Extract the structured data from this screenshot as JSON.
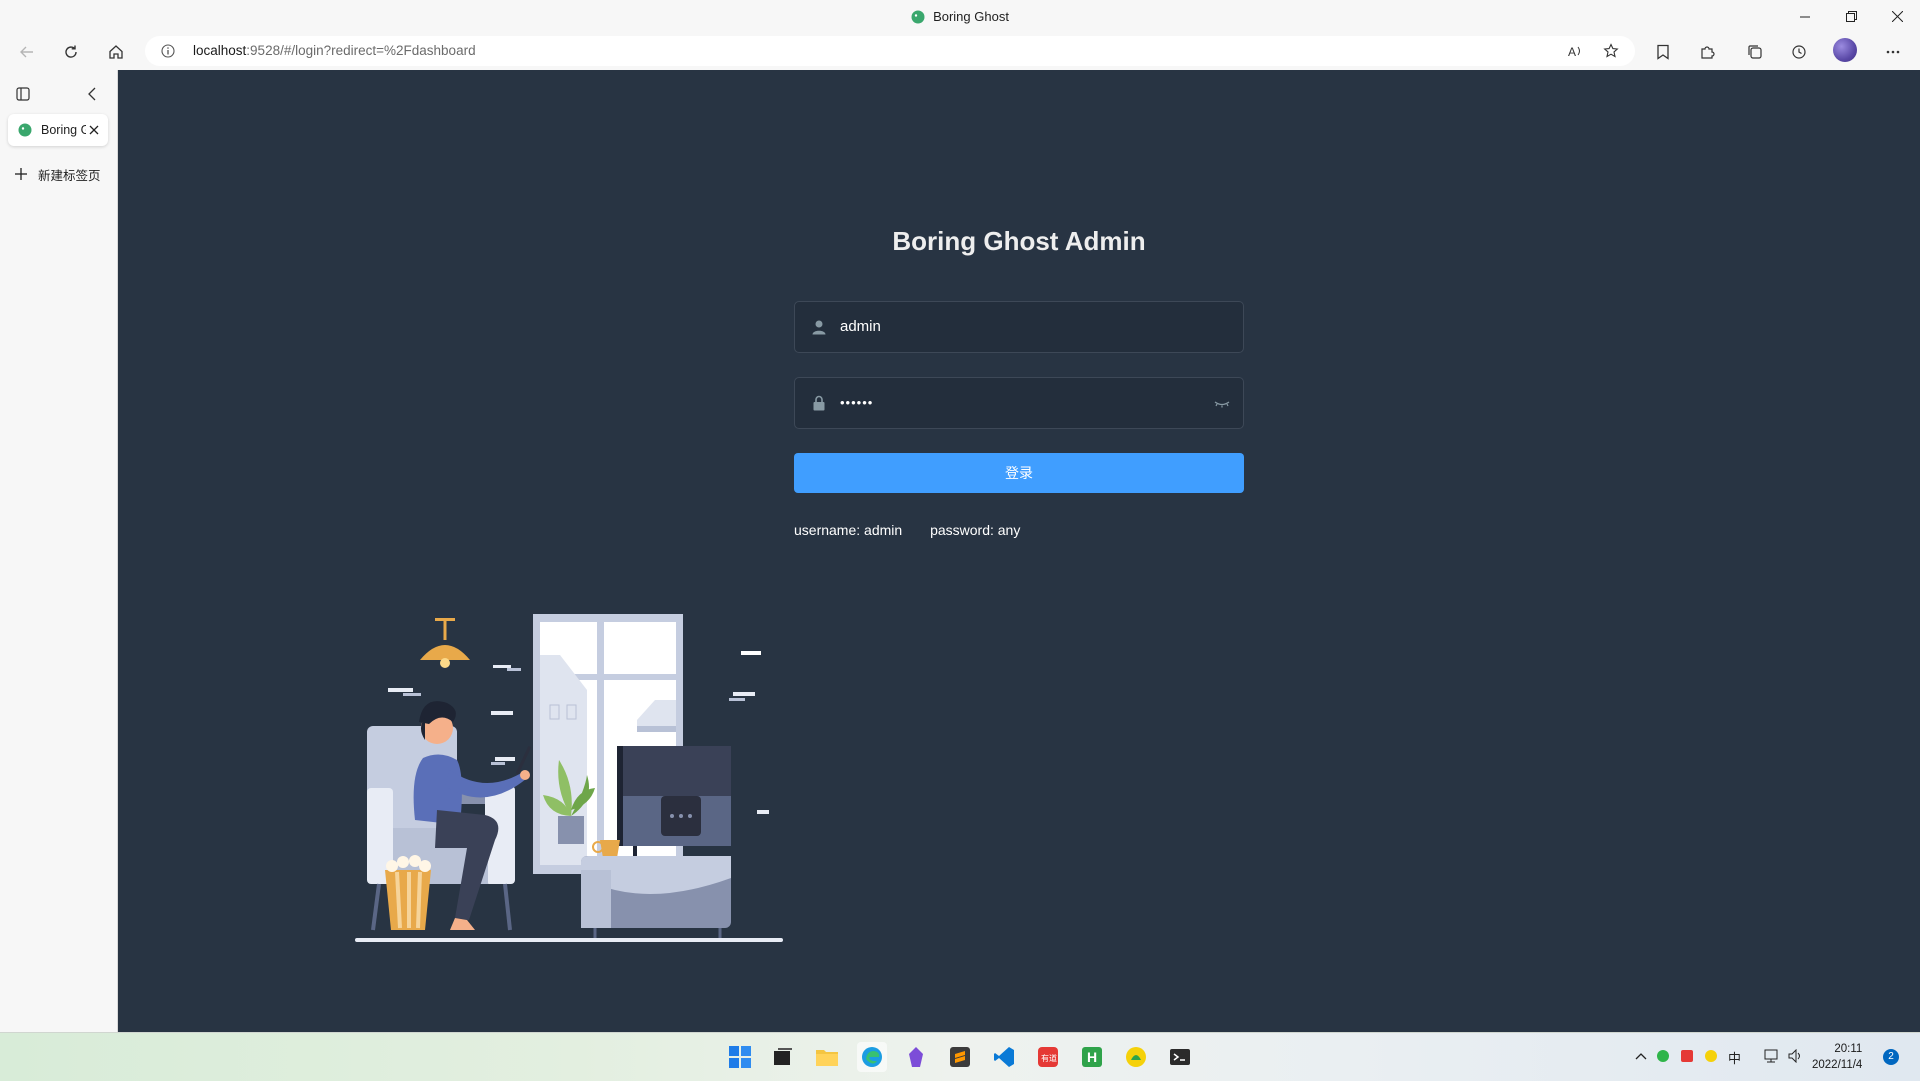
{
  "window": {
    "title": "Boring Ghost"
  },
  "address_bar": {
    "url_host": "localhost",
    "url_rest": ":9528/#/login?redirect=%2Fdashboard"
  },
  "side_panel": {
    "tab_label": "Boring Ghost",
    "new_tab_label": "新建标签页"
  },
  "login": {
    "heading": "Boring Ghost Admin",
    "username_value": "admin",
    "password_value": "••••••",
    "submit_label": "登录",
    "tip_username": "username: admin",
    "tip_password": "password: any"
  },
  "taskbar": {
    "time": "20:11",
    "date": "2022/11/4",
    "notification_count": "2",
    "ime_label": "中",
    "apps": [
      "start-icon",
      "task-view-icon",
      "file-explorer-icon",
      "edge-icon",
      "obsidian-icon",
      "sublime-icon",
      "vscode-icon",
      "youdao-icon",
      "hbuilder-icon",
      "app-icon",
      "terminal-icon"
    ]
  },
  "colors": {
    "page_bg": "#283443",
    "primary": "#409eff",
    "text_light": "#eeeeee",
    "icon_gray": "#889aa4"
  }
}
